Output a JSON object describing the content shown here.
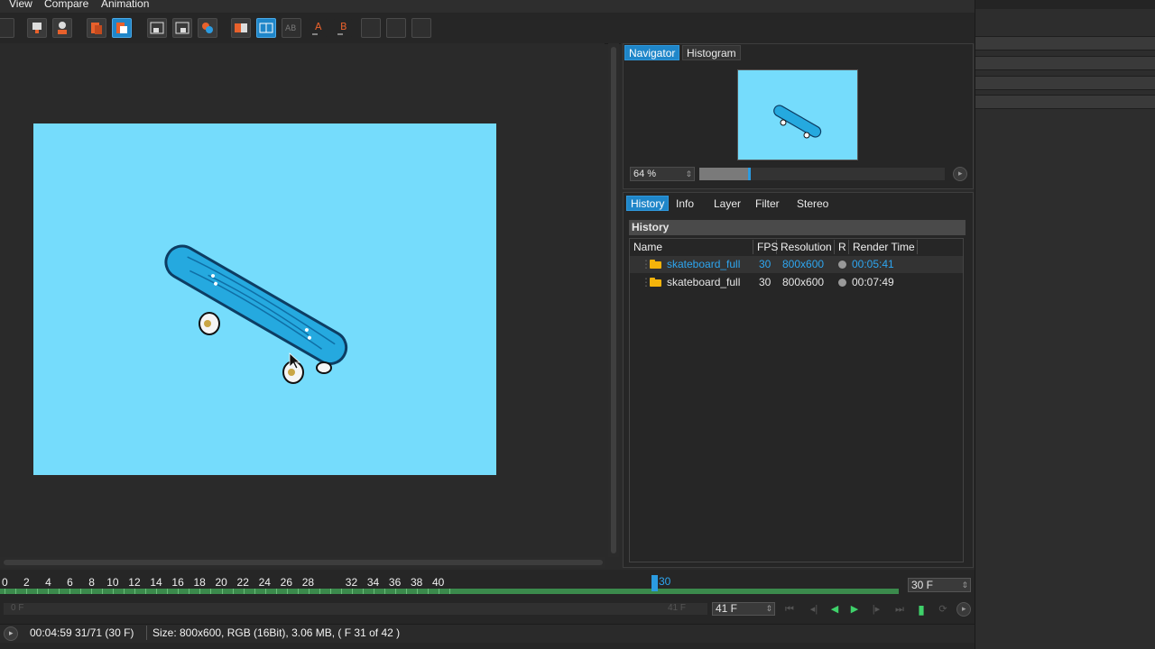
{
  "menu": {
    "items": [
      "View",
      "Compare",
      "Animation"
    ]
  },
  "toolbar": {
    "buttons": [
      {
        "name": "snapshot-button",
        "icon": "grid-icon",
        "selected": false
      },
      {
        "name": "clone-button",
        "icon": "clone-icon",
        "selected": false
      },
      {
        "name": "history-button",
        "icon": "history-icon",
        "selected": false
      },
      {
        "name": "copy-button",
        "icon": "copy-icon",
        "selected": false
      },
      {
        "name": "show-channel-button",
        "icon": "channel-icon",
        "selected": true
      },
      {
        "name": "region-button",
        "icon": "region-icon",
        "selected": false
      },
      {
        "name": "region-render-button",
        "icon": "region-render-icon",
        "selected": false
      },
      {
        "name": "compare-ab-button",
        "icon": "ab-icon",
        "selected": false
      },
      {
        "name": "split-button",
        "icon": "split-icon",
        "selected": true
      },
      {
        "name": "ab-overlay-button",
        "icon": "ab-overlay-icon",
        "selected": false
      },
      {
        "name": "set-a-button",
        "icon": "a-icon",
        "selected": false
      },
      {
        "name": "set-b-button",
        "icon": "b-icon",
        "selected": false
      },
      {
        "name": "stereo-1-button",
        "icon": "stereo-icon",
        "selected": false
      },
      {
        "name": "stereo-2-button",
        "icon": "stereo-icon",
        "selected": false
      },
      {
        "name": "stereo-3-button",
        "icon": "stereo-icon",
        "selected": false
      }
    ]
  },
  "navigator": {
    "tabs": [
      "Navigator",
      "Histogram"
    ],
    "active_tab": "Navigator",
    "zoom_label": "64 %",
    "zoom_fraction": 0.2
  },
  "history_panel": {
    "tabs": [
      "History",
      "Info",
      "Layer",
      "Filter",
      "Stereo"
    ],
    "active_tab": "History",
    "header": "History",
    "columns": [
      "Name",
      "FPS",
      "Resolution",
      "R",
      "Render Time"
    ],
    "rows": [
      {
        "name": "skateboard_full",
        "fps": "30",
        "resolution": "800x600",
        "render_time": "00:05:41",
        "selected": true
      },
      {
        "name": "skateboard_full",
        "fps": "30",
        "resolution": "800x600",
        "render_time": "00:07:49",
        "selected": false
      }
    ]
  },
  "timeline": {
    "ticks": [
      "0",
      "2",
      "4",
      "6",
      "8",
      "10",
      "12",
      "14",
      "16",
      "18",
      "20",
      "22",
      "24",
      "26",
      "28",
      "30",
      "32",
      "34",
      "36",
      "38",
      "40"
    ],
    "current_frame": "30",
    "fps_field": "30 F",
    "frame_field": "41 F",
    "range_start": "0 F",
    "range_end": "41 F"
  },
  "status": {
    "time": "00:04:59 31/71 (30 F)",
    "info": "Size: 800x600, RGB (16Bit), 3.06 MB,  ( F 31 of 42 )"
  },
  "colors": {
    "accent": "#1f86c9",
    "canvas_bg": "#75dcfc",
    "timeline_green": "#3b8a4c",
    "folder": "#f3b30b",
    "selected_row_text": "#2ea6f0"
  }
}
